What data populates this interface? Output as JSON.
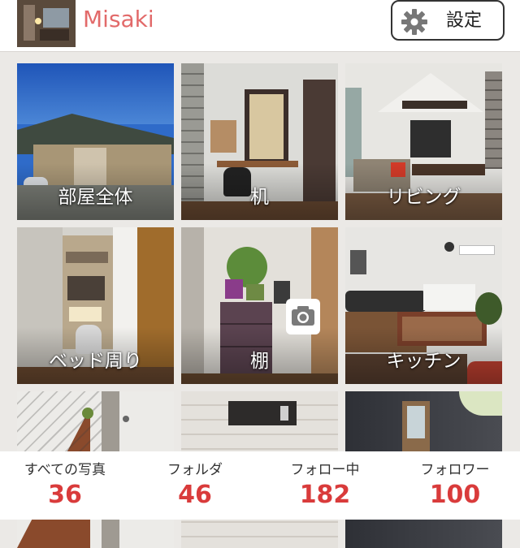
{
  "header": {
    "username": "Misaki",
    "settings_label": "設定",
    "settings_icon": "gear-icon"
  },
  "folders": [
    {
      "label": "部屋全体"
    },
    {
      "label": "机"
    },
    {
      "label": "リビング"
    },
    {
      "label": "ベッド周り"
    },
    {
      "label": "棚"
    },
    {
      "label": "キッチン"
    },
    {
      "label": ""
    },
    {
      "label": ""
    },
    {
      "label": ""
    }
  ],
  "overlay": {
    "camera_icon": "camera-icon",
    "expand_icon": "chevron-up-icon"
  },
  "stats": [
    {
      "label": "すべての写真",
      "value": "36"
    },
    {
      "label": "フォルダ",
      "value": "46"
    },
    {
      "label": "フォロー中",
      "value": "182"
    },
    {
      "label": "フォロワー",
      "value": "100"
    }
  ],
  "colors": {
    "accent": "#d93b3b",
    "username": "#e26a6a"
  }
}
